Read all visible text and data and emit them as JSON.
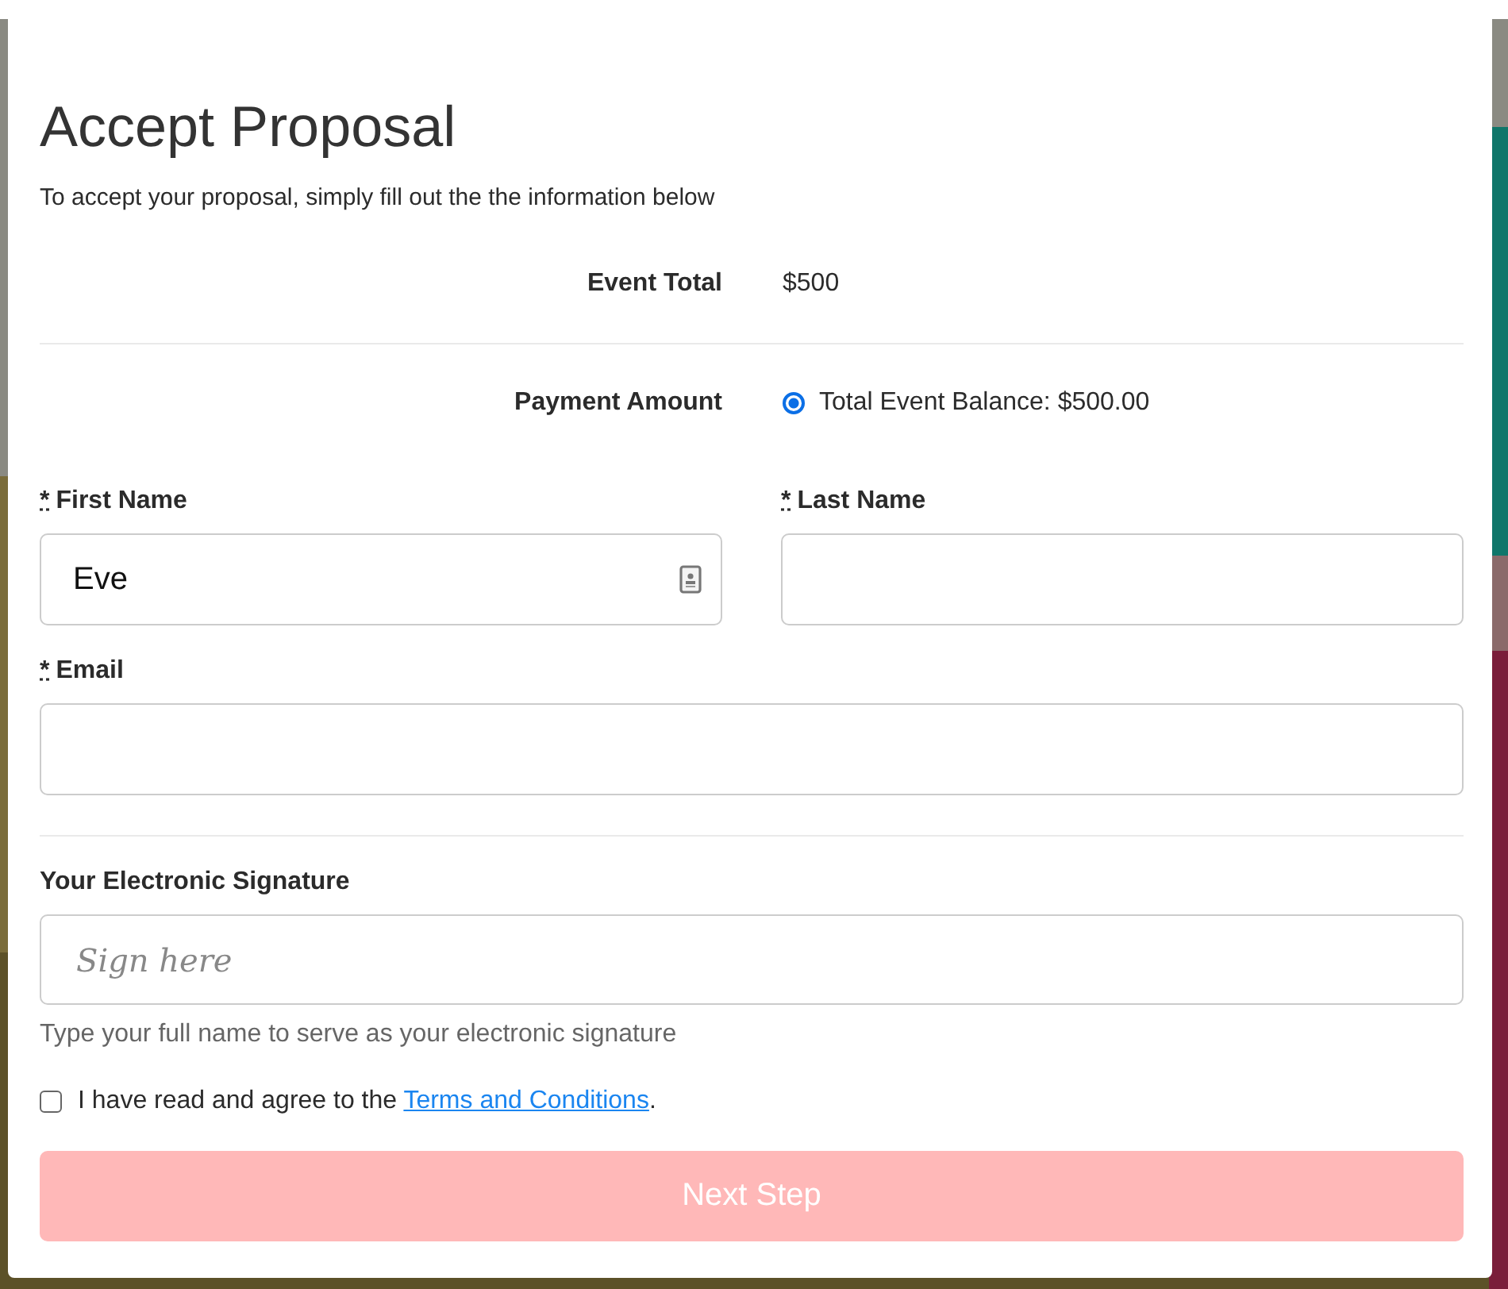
{
  "title": "Accept Proposal",
  "intro": "To accept your proposal, simply fill out the the information below",
  "event_total": {
    "label": "Event Total",
    "value": "$500"
  },
  "payment": {
    "label": "Payment Amount",
    "options": [
      {
        "label": "Total Event Balance: $500.00",
        "selected": true
      }
    ]
  },
  "name_fields": [
    {
      "label": "First Name",
      "required": true,
      "value": "Eve",
      "autofill": true
    },
    {
      "label": "Last Name",
      "required": true,
      "autofill": false
    }
  ],
  "email": {
    "label": "Email",
    "required": true
  },
  "signature": {
    "label": "Your Electronic Signature",
    "placeholder": "Sign here",
    "hint": "Type your full name to serve as your electronic signature"
  },
  "agree": {
    "checked": false,
    "text": "I have read and agree to the",
    "link": "Terms and Conditions",
    "end": "."
  },
  "next_button": {
    "label": "Next Step",
    "disabled": true
  },
  "required_mark": "*"
}
